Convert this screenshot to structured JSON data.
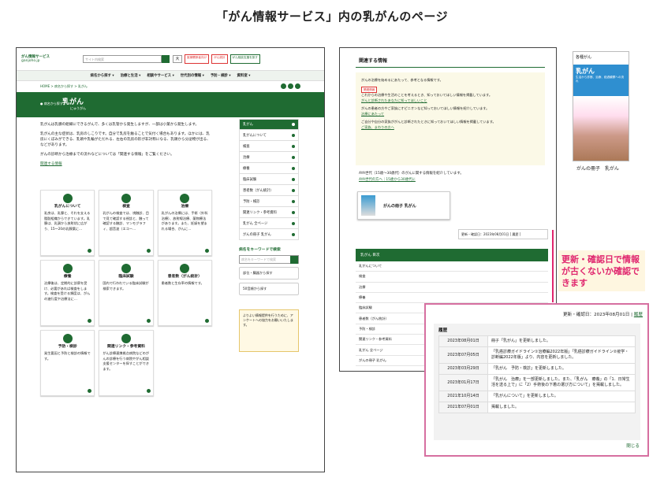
{
  "title": "「がん情報サービス」内の乳がんのページ",
  "left": {
    "logo1": "がん情報サービス",
    "logo2": "ganjoho.jp",
    "search_placeholder": "サイト内検索",
    "size": "大",
    "pills": [
      "医療関係者向け",
      "がん統計",
      "がん相談支援を探す"
    ],
    "nav": [
      "病名から探す ▾",
      "治療と生活 ▾",
      "相談やサービス ▾",
      "世代別の情報 ▾",
      "予防・検診 ▾",
      "資料室 ▾"
    ],
    "crumbs": "HOME > 病名から探す > 乳がん",
    "back": "● 病名から探す",
    "heading": "乳がん",
    "reading": "にゅうがん",
    "intro": [
      "乳がんは乳腺の組織にできるがんで、多くは乳管から発生しますが、一部は小葉から発生します。",
      "乳がんの主な症状は、乳房のしこりです。自分で乳房を触ることで気付く場合もあります。ほかには、乳房にくぼみができる、乳頭や乳輪がただれる、左右の乳房の形が非対称になる、乳頭から分泌物が出る、などがあります。",
      "がんの診断から治療までの流れなどについては「関連する情報」をご覧ください。"
    ],
    "intro_link": "関連する情報",
    "cards": [
      {
        "t": "乳がんについて",
        "b": "乳房は、乳腺と、それを支える脂肪組織からできています。乳腺は、乳頭から放射状に広がり、15～20の乳腺葉に…"
      },
      {
        "t": "検査",
        "b": "乳がんの検査では、視触診、目で見て確認する視診と、触って確認する触診、マンモグラフィ、超音波（エコー…"
      },
      {
        "t": "治療",
        "b": "乳がんの治療には、手術（外科治療）、放射線治療、薬物療法があります。また、妊娠を望まれる場合、がんに…"
      },
      {
        "t": "療養",
        "b": "治療後は、定期的に診察を受け、必要があれば検査をします。検査を受ける頻度は、がんの進行度や治療法に…"
      },
      {
        "t": "臨床試験",
        "b": "国内で行われている臨床試験が検索できます。"
      },
      {
        "t": "患者数（がん統計）",
        "b": "患者数と生存率の情報です。"
      },
      {
        "t": "予防・検診",
        "b": "発生要因と予防と検診の情報です。"
      },
      {
        "t": "関連リンク・参考資料",
        "b": "がん診療連携拠点病院などのがんの診療を行う病院やがん相談支援センターを探すことができます。"
      }
    ],
    "sidebar": [
      "乳がん",
      "乳がんについて",
      "検査",
      "治療",
      "療養",
      "臨床試験",
      "患者数（がん統計）",
      "予防・検診",
      "関連リンク・参考資料",
      "乳がん 全ページ",
      "がんの冊子 乳がん"
    ],
    "kw_title": "病名をキーワードで検索",
    "kw_placeholder": "病名をキーワードで検索",
    "kbtns": [
      "部位・臓器から探す",
      "50音順から探す"
    ],
    "survey": "よりよい情報提供を行うために、アンケートへの協力をお願いいたします。"
  },
  "mid": {
    "heading": "関連する情報",
    "box": [
      "がんの治療を始めるにあたって、参考となる情報です。",
      "これからの治療や生活のことを考えるとき、知っておいてほしい情報を掲載しています。",
      "がんの患者の方やご家族にオピニオンなど知っておいてほしい情報を紹介しています。",
      "ご自分や自分の家族ががんと診断されたときに知っておいてほしい情報を掲載しています。"
    ],
    "tag": "関連情報",
    "links": [
      "がんと診断されたあなたに知ってほしいこと",
      "治療にあたって",
      "ご家族、まわりの方へ"
    ],
    "aya": "AYA世代（15歳～30歳代）のがんに関する情報を紹介しています。",
    "aya_link": "AYA世代の方へ｜15歳から30歳代に",
    "book": "がんの冊子 乳がん",
    "update": "更新・確認日：2023年08月01日 [ 履歴 ]",
    "toc_h": "乳がん 目次",
    "toc": [
      "乳がんについて",
      "検査",
      "治療",
      "療養",
      "臨床試験",
      "患者数（がん統計）",
      "予防・検診",
      "関連リンク・参考資料",
      "乳がん 全ページ",
      "がんの冊子 乳がん"
    ]
  },
  "cover": {
    "top": "各種がん",
    "big": "乳がん",
    "sm": "生活から診断、治療、経過観察への流れ",
    "label": "がんの冊子　乳がん"
  },
  "annotation": "更新・確認日で情報が古くないか確認できます",
  "popup": {
    "header": "更新・確認日：2023年08月01日 | ",
    "header_link": "履歴",
    "label": "履歴",
    "rows": [
      {
        "d": "2023年08月01日",
        "t": "冊子「乳がん」を更新しました。"
      },
      {
        "d": "2023年07月05日",
        "t": "「乳癌診療ガイドライン①治療編2022年版」「乳癌診療ガイドライン②疫学・診断編2022年版」より、内容を更新しました。"
      },
      {
        "d": "2023年03月29日",
        "t": "「乳がん　予防・検診」を更新しました。"
      },
      {
        "d": "2023年01月17日",
        "t": "「乳がん　治療」を一部更新しました。また、「乳がん　療養」の「1．日常生活を送る上で」に「2）手術後の下着の選び方について」を掲載しました。"
      },
      {
        "d": "2021年10月14日",
        "t": "「乳がんについて」を更新しました。"
      },
      {
        "d": "2021年07月01日",
        "t": "掲載しました。"
      }
    ],
    "close": "閉じる"
  }
}
